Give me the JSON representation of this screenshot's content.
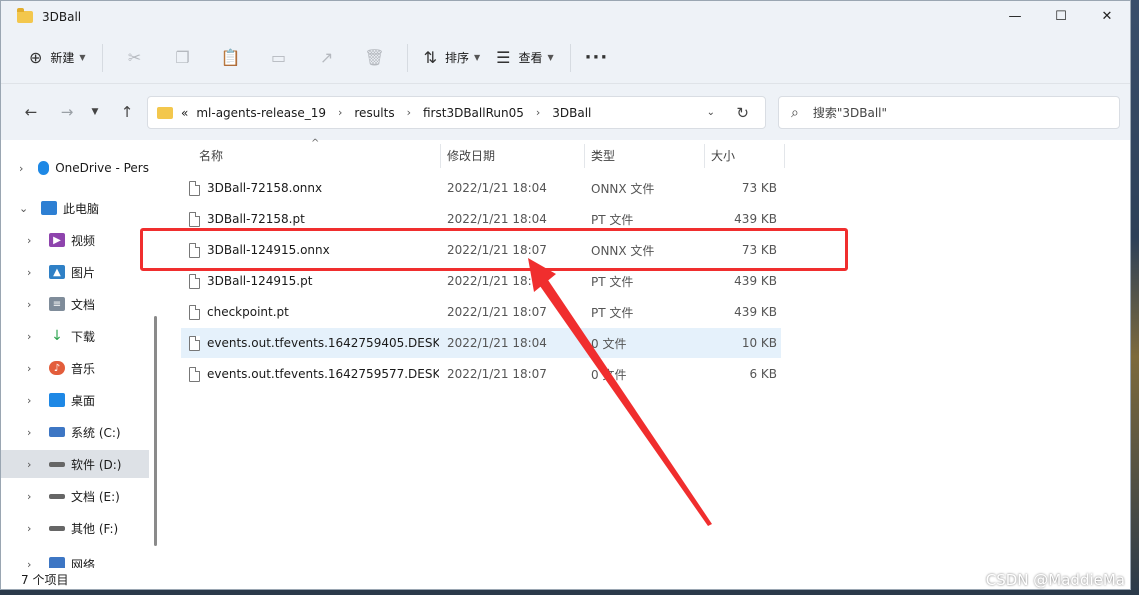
{
  "window": {
    "title": "3DBall",
    "minimize": "—",
    "maximize": "☐",
    "close": "✕"
  },
  "toolbar": {
    "new_label": "新建",
    "sort_label": "排序",
    "view_label": "查看",
    "more": "···"
  },
  "address": {
    "crumbs": [
      "ml-agents-release_19",
      "results",
      "first3DBallRun05",
      "3DBall"
    ],
    "overflow": "«"
  },
  "search": {
    "placeholder": "搜索\"3DBall\""
  },
  "sidebar": {
    "items": [
      {
        "label": "OneDrive - Pers",
        "color": "#1e88e5"
      },
      {
        "label": "此电脑",
        "color": "#2d7fd3"
      },
      {
        "label": "视频",
        "color": "#8e44ad"
      },
      {
        "label": "图片",
        "color": "#2f80c6"
      },
      {
        "label": "文档",
        "color": "#7f8c9a"
      },
      {
        "label": "下载",
        "color": "#2ea44f"
      },
      {
        "label": "音乐",
        "color": "#e35d3b"
      },
      {
        "label": "桌面",
        "color": "#1e88e5"
      },
      {
        "label": "系统 (C:)",
        "color": "#3d76c4"
      },
      {
        "label": "软件 (D:)",
        "color": "#666666"
      },
      {
        "label": "文档 (E:)",
        "color": "#666666"
      },
      {
        "label": "其他 (F:)",
        "color": "#666666"
      },
      {
        "label": "网络",
        "color": "#3d76c4"
      }
    ]
  },
  "columns": {
    "name": "名称",
    "date": "修改日期",
    "type": "类型",
    "size": "大小"
  },
  "files": [
    {
      "name": "3DBall-72158.onnx",
      "date": "2022/1/21 18:04",
      "type": "ONNX 文件",
      "size": "73 KB"
    },
    {
      "name": "3DBall-72158.pt",
      "date": "2022/1/21 18:04",
      "type": "PT 文件",
      "size": "439 KB"
    },
    {
      "name": "3DBall-124915.onnx",
      "date": "2022/1/21 18:07",
      "type": "ONNX 文件",
      "size": "73 KB"
    },
    {
      "name": "3DBall-124915.pt",
      "date": "2022/1/21 18:07",
      "type": "PT 文件",
      "size": "439 KB"
    },
    {
      "name": "checkpoint.pt",
      "date": "2022/1/21 18:07",
      "type": "PT 文件",
      "size": "439 KB"
    },
    {
      "name": "events.out.tfevents.1642759405.DESK...",
      "date": "2022/1/21 18:04",
      "type": "0 文件",
      "size": "10 KB"
    },
    {
      "name": "events.out.tfevents.1642759577.DESK...",
      "date": "2022/1/21 18:07",
      "type": "0 文件",
      "size": "6 KB"
    }
  ],
  "status": {
    "item_count": "7 个项目"
  },
  "watermark": "CSDN @MaddieMa",
  "annotation_color": "#f02e2e"
}
